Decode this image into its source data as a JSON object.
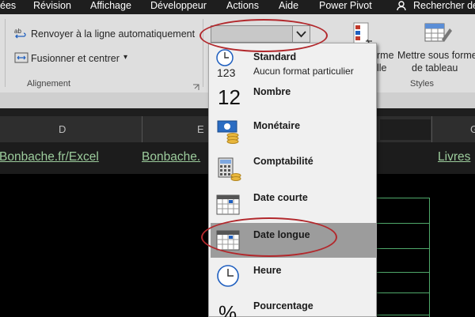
{
  "menubar": {
    "items": [
      "ées",
      "Révision",
      "Affichage",
      "Développeur",
      "Actions",
      "Aide",
      "Power Pivot"
    ],
    "search": "Rechercher de"
  },
  "ribbon": {
    "wrap_text": "Renvoyer à la ligne automatiquement",
    "merge_center": "Fusionner et centrer",
    "alignment_group": "Alignement",
    "cond_format_partial_1": "rme",
    "cond_format_partial_2": "lle",
    "format_table_1": "Mettre sous forme",
    "format_table_2": "de tableau",
    "styles_group": "Styles"
  },
  "number_format": {
    "current_value": ""
  },
  "sheet": {
    "columns": [
      "D",
      "E",
      "G"
    ],
    "links": [
      "Bonbache.fr/Excel",
      "Bonbache.",
      "Livres"
    ]
  },
  "dropdown": {
    "items": [
      {
        "title": "Standard",
        "subtitle": "Aucun format particulier",
        "icon": "clock-123-icon"
      },
      {
        "title": "Nombre",
        "subtitle": "",
        "icon": "number-12-icon"
      },
      {
        "title": "Monétaire",
        "subtitle": "",
        "icon": "money-icon"
      },
      {
        "title": "Comptabilité",
        "subtitle": "",
        "icon": "calculator-icon"
      },
      {
        "title": "Date courte",
        "subtitle": "",
        "icon": "calendar-icon"
      },
      {
        "title": "Date longue",
        "subtitle": "",
        "icon": "calendar-icon"
      },
      {
        "title": "Heure",
        "subtitle": "",
        "icon": "clock-icon"
      },
      {
        "title": "Pourcentage",
        "subtitle": "",
        "icon": "percent-icon"
      }
    ],
    "number_glyph": "12",
    "percent_glyph": "%",
    "standard_digits": "123",
    "selected_index": 5
  },
  "colors": {
    "annotation": "#b2282c",
    "link": "#9ccc9c",
    "selection": "#9c9c9c"
  }
}
